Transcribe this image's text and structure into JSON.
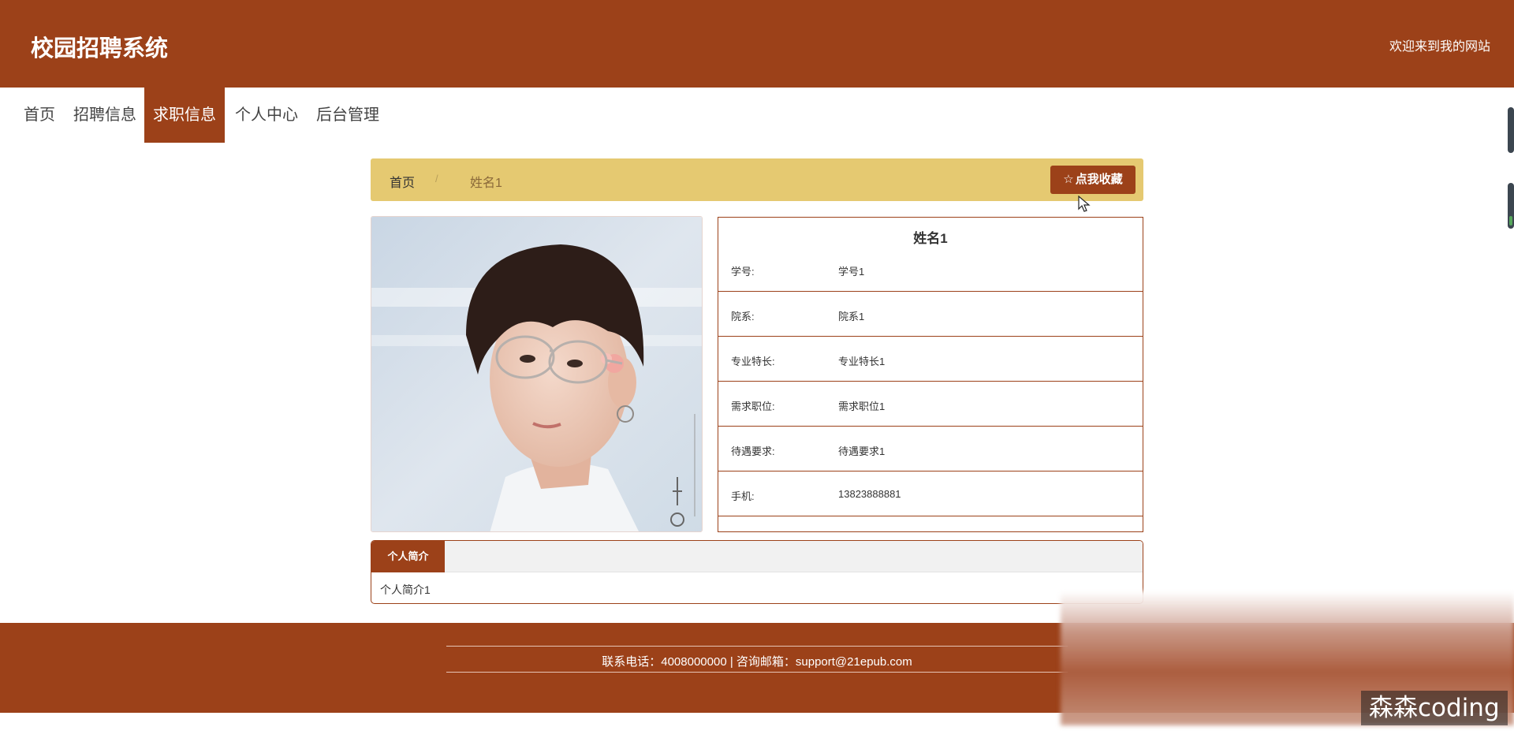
{
  "header": {
    "site_title": "校园招聘系统",
    "welcome": "欢迎来到我的网站"
  },
  "nav": {
    "items": [
      {
        "label": "首页",
        "active": false
      },
      {
        "label": "招聘信息",
        "active": false
      },
      {
        "label": "求职信息",
        "active": true
      },
      {
        "label": "个人中心",
        "active": false
      },
      {
        "label": "后台管理",
        "active": false
      }
    ]
  },
  "breadcrumb": {
    "home": "首页",
    "separator": "/",
    "current": "姓名1",
    "favorite_button": "点我收藏",
    "favorite_icon": "star-outline-icon"
  },
  "profile": {
    "name": "姓名1",
    "photo_alt": "avatar photo",
    "fields": [
      {
        "label": "学号:",
        "value": "学号1"
      },
      {
        "label": "院系:",
        "value": "院系1"
      },
      {
        "label": "专业特长:",
        "value": "专业特长1"
      },
      {
        "label": "需求职位:",
        "value": "需求职位1"
      },
      {
        "label": "待遇要求:",
        "value": "待遇要求1"
      },
      {
        "label": "手机:",
        "value": "13823888881"
      }
    ]
  },
  "intro": {
    "tab_label": "个人简介",
    "content": "个人简介1"
  },
  "footer": {
    "contact": "联系电话：4008000000 | 咨询邮箱：support@21epub.com"
  },
  "overlay": {
    "watermark": "森森coding"
  },
  "colors": {
    "primary": "#9c4119",
    "breadcrumb_bg": "#e5c971"
  }
}
